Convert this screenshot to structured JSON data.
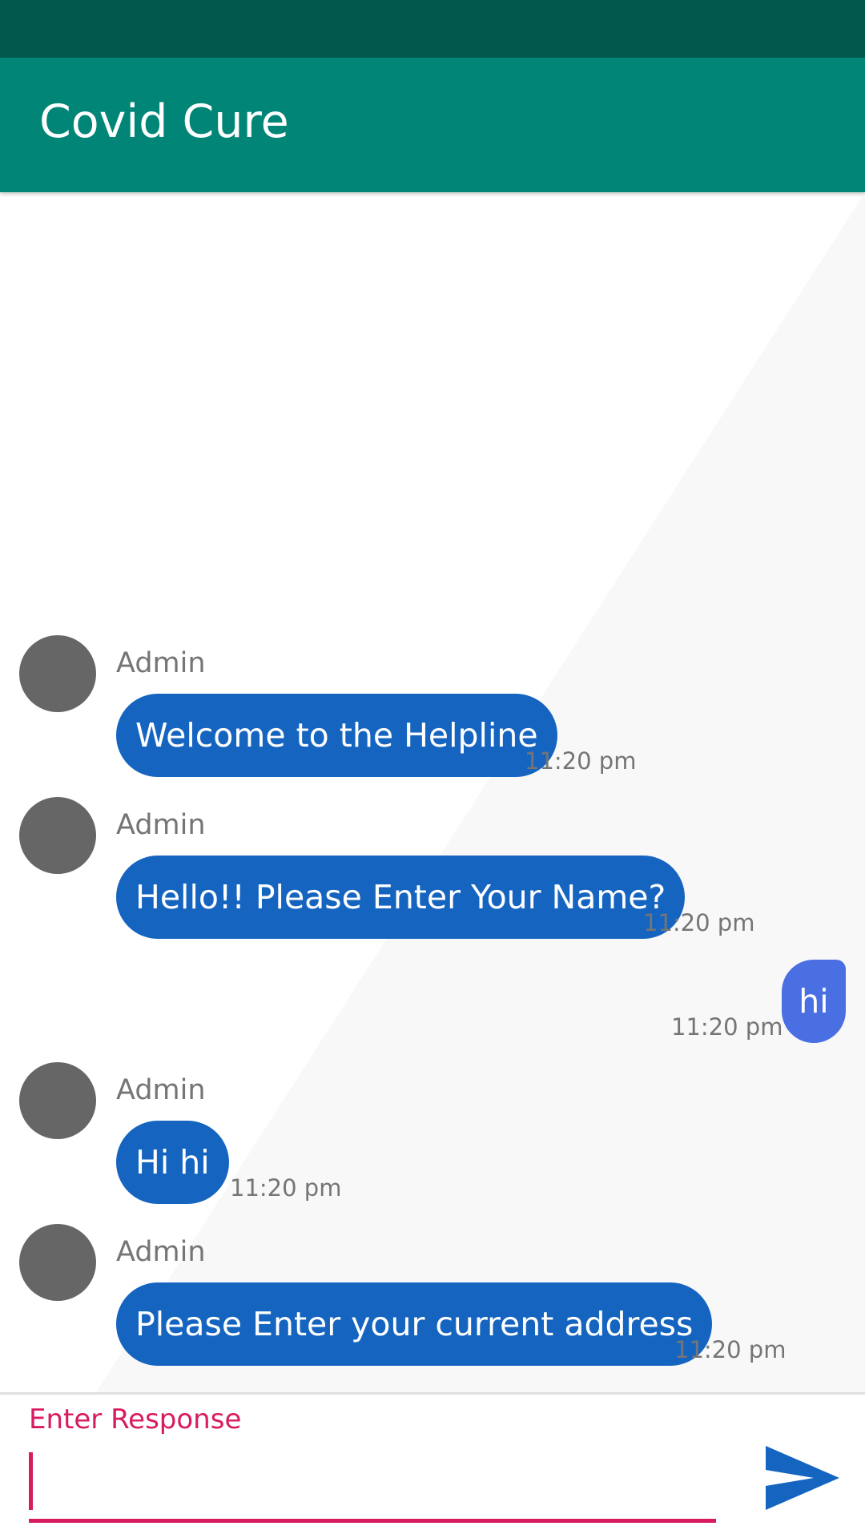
{
  "colors": {
    "status_bar": "#00574B",
    "app_bar": "#008577",
    "admin_bubble": "#1565C0",
    "user_bubble": "#4A6FE3",
    "avatar": "#666666",
    "accent": "#D81B60",
    "send_icon": "#1565C0",
    "bg_shape": "#F8F8F8"
  },
  "app_bar": {
    "title": "Covid Cure"
  },
  "messages": [
    {
      "type": "admin",
      "sender": "Admin",
      "text": "Welcome to the Helpline",
      "time": "11:20 pm"
    },
    {
      "type": "admin",
      "sender": "Admin",
      "text": "Hello!! Please Enter Your Name?",
      "time": "11:20 pm"
    },
    {
      "type": "user",
      "text": "hi",
      "time": "11:20 pm"
    },
    {
      "type": "admin",
      "sender": "Admin",
      "text": "Hi hi",
      "time": "11:20 pm"
    },
    {
      "type": "admin",
      "sender": "Admin",
      "text": "Please Enter  your current address",
      "time": "11:20 pm"
    }
  ],
  "input": {
    "label": "Enter Response",
    "value": ""
  },
  "icons": {
    "send": "send-icon",
    "avatar": "avatar"
  }
}
